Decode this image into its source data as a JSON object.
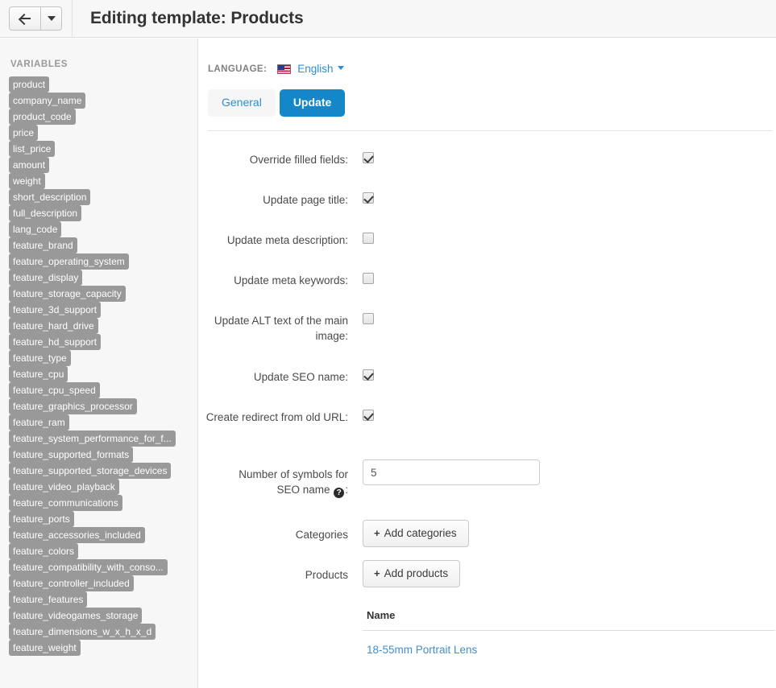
{
  "topbar": {
    "back_icon": "arrow-left-icon",
    "back_caret_icon": "chevron-down-icon",
    "title": "Editing template: Products"
  },
  "sidebar": {
    "heading": "VARIABLES",
    "variables": [
      "product",
      "company_name",
      "product_code",
      "price",
      "list_price",
      "amount",
      "weight",
      "short_description",
      "full_description",
      "lang_code",
      "feature_brand",
      "feature_operating_system",
      "feature_display",
      "feature_storage_capacity",
      "feature_3d_support",
      "feature_hard_drive",
      "feature_hd_support",
      "feature_type",
      "feature_cpu",
      "feature_cpu_speed",
      "feature_graphics_processor",
      "feature_ram",
      "feature_system_performance_for_f...",
      "feature_supported_formats",
      "feature_supported_storage_devices",
      "feature_video_playback",
      "feature_communications",
      "feature_ports",
      "feature_accessories_included",
      "feature_colors",
      "feature_compatibility_with_conso...",
      "feature_controller_included",
      "feature_features",
      "feature_videogames_storage",
      "feature_dimensions_w_x_h_x_d",
      "feature_weight"
    ]
  },
  "main": {
    "language": {
      "label": "LANGUAGE:",
      "flag_icon": "us-flag-icon",
      "value": "English",
      "caret_icon": "chevron-down-icon"
    },
    "tabs": [
      {
        "label": "General",
        "active": false
      },
      {
        "label": "Update",
        "active": true
      }
    ],
    "form": {
      "checkboxes": [
        {
          "label": "Override filled fields:",
          "checked": true,
          "two_line": false
        },
        {
          "label": "Update page title:",
          "checked": true,
          "two_line": false
        },
        {
          "label": "Update meta description:",
          "checked": false,
          "two_line": false
        },
        {
          "label": "Update meta keywords:",
          "checked": false,
          "two_line": false
        },
        {
          "label": "Update ALT text of the main image:",
          "checked": false,
          "two_line": true
        },
        {
          "label": "Update SEO name:",
          "checked": true,
          "two_line": false
        },
        {
          "label": "Create redirect from old URL:",
          "checked": true,
          "two_line": true
        }
      ],
      "symbols_field": {
        "label_part1": "Number of symbols for",
        "label_part2": "SEO name",
        "help_icon": "help-icon",
        "help_glyph": "?",
        "label_suffix": ":",
        "value": "5"
      },
      "categories": {
        "label": "Categories",
        "button_plus": "+",
        "button_label": "Add categories"
      },
      "products": {
        "label": "Products",
        "button_plus": "+",
        "button_label": "Add products",
        "table": {
          "columns": [
            "Name"
          ],
          "rows": [
            [
              "18-55mm Portrait Lens"
            ]
          ]
        }
      }
    }
  },
  "colors": {
    "accent_blue": "#1487c8",
    "link_blue": "#2e8fd0",
    "tag_gray": "#999999",
    "panel_gray": "#f7f7f7"
  }
}
